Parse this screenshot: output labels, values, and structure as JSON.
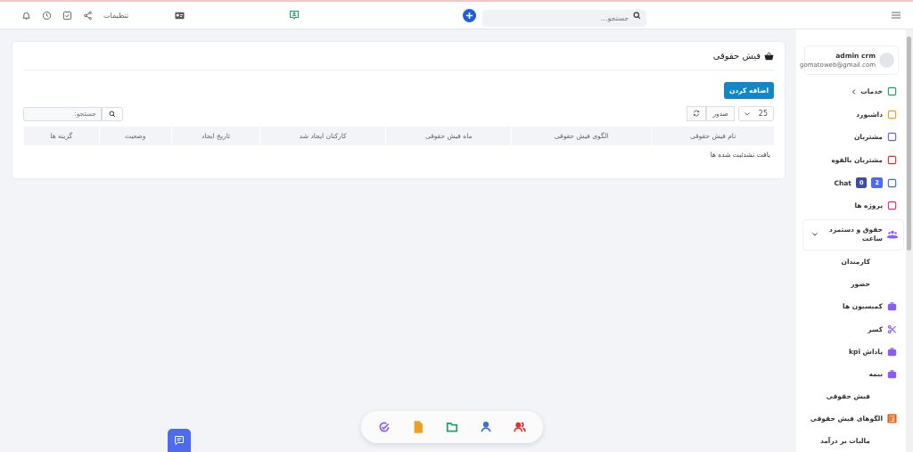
{
  "topbar": {
    "search": {
      "placeholder": "جستجو..."
    },
    "settings_label": "تنظیمات"
  },
  "sidebar": {
    "user": {
      "name": "admin crm",
      "email": "gomatoweb@gmail.com"
    },
    "items": [
      {
        "label": "خدمات",
        "kind": "caret",
        "color": "#22a06b"
      },
      {
        "label": "داشبورد",
        "kind": "plain",
        "color": "#f0a020"
      },
      {
        "label": "مشتریان",
        "kind": "plain",
        "color": "#6c63d9"
      },
      {
        "label": "مشتریان بالقوه",
        "kind": "plain",
        "color": "#e03131"
      },
      {
        "label": "Chat",
        "kind": "badges",
        "color": "#3b6fd9",
        "badges": [
          "2",
          "0"
        ]
      },
      {
        "label": "پروژه ها",
        "kind": "plain",
        "color": "#d6338a"
      },
      {
        "label": "حقوق و دستمزد ساعت",
        "kind": "group",
        "color": "#8b5cf6",
        "expanded": true,
        "children": [
          {
            "label": "کارمندان",
            "icon": false
          },
          {
            "label": "حضور",
            "icon": false
          },
          {
            "label": "کمیسیون ها",
            "icon": true,
            "color": "#8b5cf6"
          },
          {
            "label": "کسر",
            "icon": true,
            "color": "#8b5cf6"
          },
          {
            "label": "پاداش kpi",
            "icon": true,
            "color": "#8b5cf6"
          },
          {
            "label": "بیمه",
            "icon": true,
            "color": "#8b5cf6"
          },
          {
            "label": "فیش حقوقی",
            "icon": false
          },
          {
            "label": "الگوهای فیش حقوقی",
            "icon": true,
            "color": "#e8590c"
          },
          {
            "label": "مالیات بر درآمد",
            "icon": false
          }
        ]
      }
    ]
  },
  "card": {
    "title": "فیش حقوقی",
    "add_button": "اضافه کردن",
    "page_size": "25",
    "export_button": "صدور",
    "search": {
      "placeholder": "جستجو:"
    },
    "table": {
      "columns": [
        "نام فیش حقوقی",
        "الگوی فیش حقوقی",
        "ماه فیش حقوقی",
        "کارکنان ایجاد شد",
        "تاریخ ایجاد",
        "وضعیت",
        "گزینه ها"
      ],
      "empty_message": "یافت نشدثبت شده ها"
    }
  },
  "dock": {
    "items": [
      {
        "color": "#e03131"
      },
      {
        "color": "#3b6fd9"
      },
      {
        "color": "#22a06b"
      },
      {
        "color": "#f0a020"
      },
      {
        "color": "#8b5cf6"
      }
    ]
  }
}
